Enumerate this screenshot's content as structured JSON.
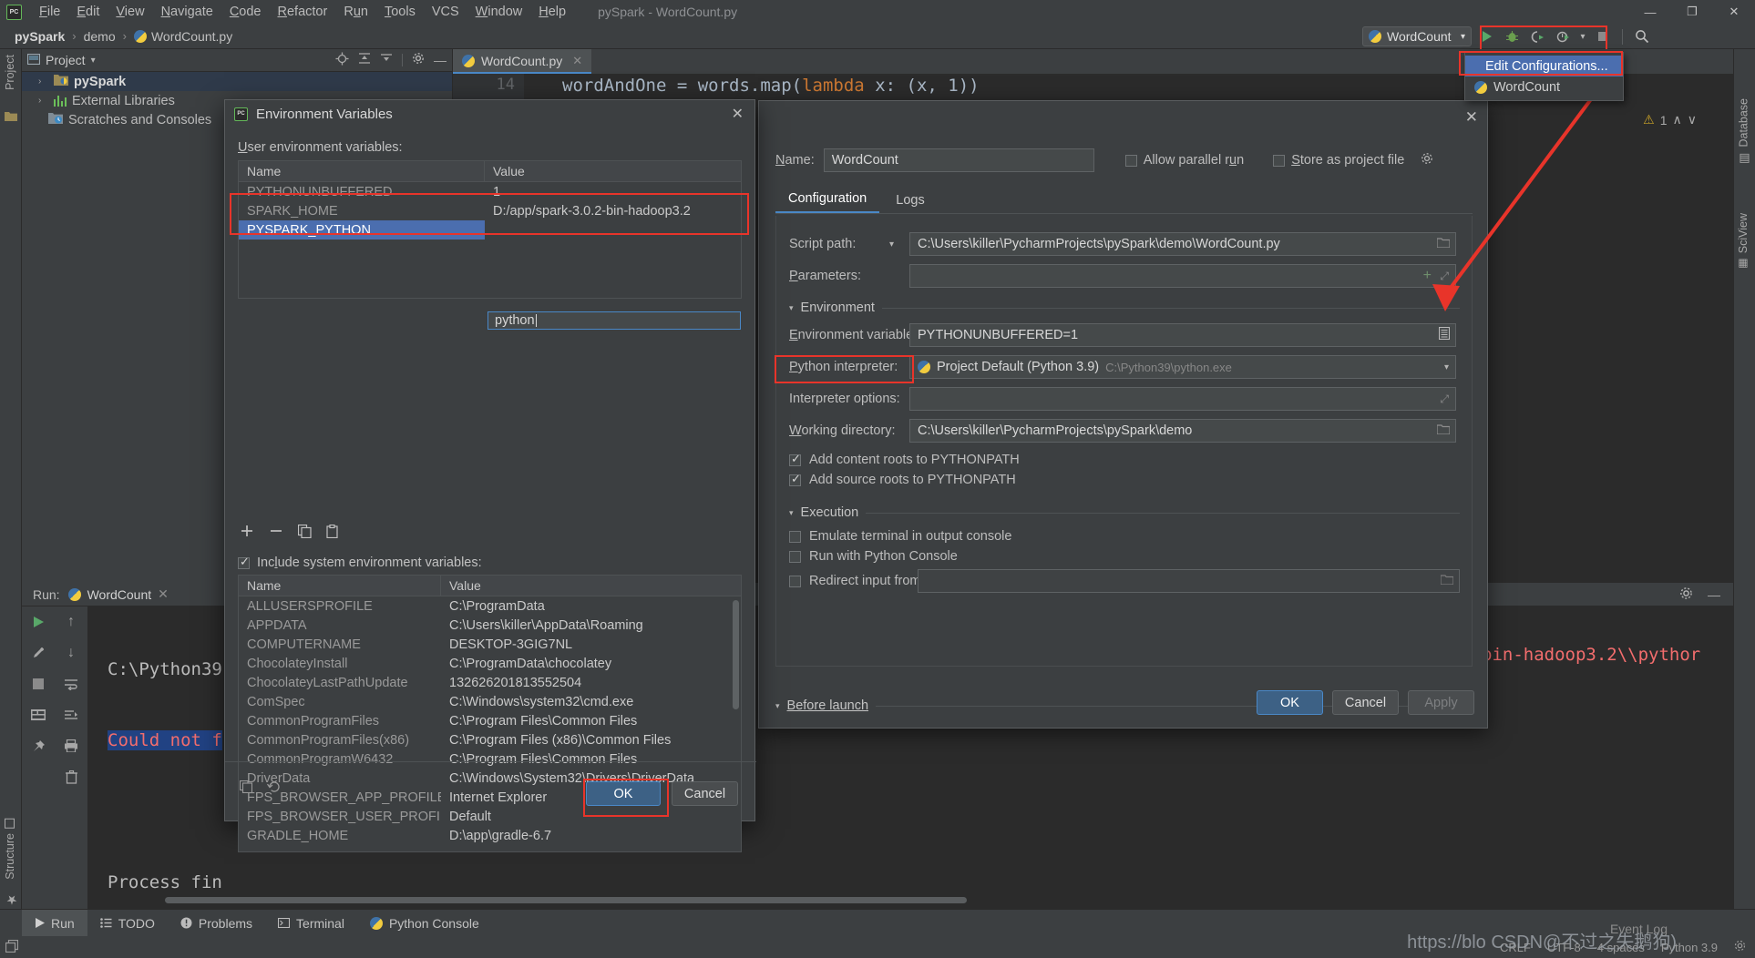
{
  "titlebar": {
    "logo": "PC",
    "menus": [
      "File",
      "Edit",
      "View",
      "Navigate",
      "Code",
      "Refactor",
      "Run",
      "Tools",
      "VCS",
      "Window",
      "Help"
    ],
    "window_title": "pySpark - WordCount.py",
    "minimize": "—",
    "maximize": "❐",
    "close": "✕"
  },
  "navbar": {
    "breadcrumb": [
      "pySpark",
      "demo",
      "WordCount.py"
    ],
    "separator": "›"
  },
  "run_widget": {
    "config_name": "WordCount",
    "caret": "▾",
    "run_icon": "run-icon",
    "debug_icon": "debug-icon",
    "coverage_icon": "coverage-icon",
    "profile_icon": "profile-icon",
    "stop_icon": "stop-icon",
    "search_icon": "search-icon",
    "dropdown": {
      "items": [
        {
          "label": "Edit Configurations...",
          "selected": true,
          "icon": null
        },
        {
          "label": "WordCount",
          "selected": false,
          "icon": "python-icon"
        }
      ]
    }
  },
  "left_strip": {
    "project_tab": "Project",
    "structure_tab": "Structure",
    "favorites_tab": "Favorites"
  },
  "right_strip": {
    "database_tab": "Database",
    "sciview_tab": "SciView"
  },
  "project_panel": {
    "title": "Project",
    "caret": "▾",
    "tree": [
      {
        "label": "pySpark",
        "arrow": "›",
        "icon": "python-module-folder-icon",
        "selected": true,
        "bold": true
      },
      {
        "label": "External Libraries",
        "arrow": "›",
        "icon": "libraries-icon",
        "selected": false,
        "bold": false
      },
      {
        "label": "Scratches and Consoles",
        "arrow": "",
        "icon": "scratches-icon",
        "selected": false,
        "bold": false
      }
    ]
  },
  "editor": {
    "tab_label": "WordCount.py",
    "tab_close": "✕",
    "line_number": "14",
    "code_pre": "wordAndOne = words.map(",
    "code_kw": "lambda",
    "code_post": " x: (x, 1))",
    "warning_count": "1",
    "warning_glyph": "⚠",
    "nav_up": "∧",
    "nav_down": "∨"
  },
  "run_panel": {
    "label": "Run:",
    "tab_name": "WordCount",
    "tab_close": "✕",
    "console_lines": [
      {
        "text": "C:\\Python39",
        "style": "plain"
      },
      {
        "text": "Could not f",
        "style": "error-highlight"
      },
      {
        "text": "",
        "style": "plain"
      },
      {
        "text": "Process fin",
        "style": "plain"
      }
    ],
    "console_right_text": "bin-hadoop3.2\\\\pythor",
    "settings_icon": "gear-icon",
    "hide_icon": "minimize-icon"
  },
  "bottombar": {
    "items": [
      {
        "label": "Run",
        "icon": "run-icon",
        "active": true
      },
      {
        "label": "TODO",
        "icon": "todo-icon",
        "active": false
      },
      {
        "label": "Problems",
        "icon": "problems-icon",
        "active": false
      },
      {
        "label": "Terminal",
        "icon": "terminal-icon",
        "active": false
      },
      {
        "label": "Python Console",
        "icon": "python-icon",
        "active": false
      }
    ]
  },
  "statusbar": {
    "line_sep": "CRLF",
    "encoding": "UTF-8",
    "indent": "4 spaces",
    "interpreter": "Python 3.9",
    "event_log": "Event Log",
    "gear_icon": "gear-icon",
    "watermark_url": "https://blo CSDN@不过之失鹅狗)",
    "watermark_alt": "https://blog.csdn.net"
  },
  "config_dialog": {
    "close": "✕",
    "name_label": "Name:",
    "name_value": "WordCount",
    "allow_parallel_label": "Allow parallel run",
    "allow_parallel_checked": false,
    "store_project_label": "Store as project file",
    "store_project_checked": false,
    "gear_icon": "gear-icon",
    "tabs": [
      {
        "label": "Configuration",
        "selected": true
      },
      {
        "label": "Logs",
        "selected": false
      }
    ],
    "script_path_label": "Script path:",
    "script_path_caret": "▾",
    "script_path_value": "C:\\Users\\killer\\PycharmProjects\\pySpark\\demo\\WordCount.py",
    "script_path_browse_icon": "folder-icon",
    "parameters_label": "Parameters:",
    "parameters_value": "",
    "parameters_add_icon": "plus-icon",
    "parameters_expand_icon": "expand-icon",
    "environment_section": "Environment",
    "env_vars_label": "Environment variables:",
    "env_vars_value": "PYTHONUNBUFFERED=1",
    "env_vars_browse_icon": "env-list-icon",
    "interpreter_label": "Python interpreter:",
    "interpreter_value": "Project Default (Python 3.9)",
    "interpreter_hint": "C:\\Python39\\python.exe",
    "interpreter_caret": "▾",
    "interpreter_options_label": "Interpreter options:",
    "interpreter_options_value": "",
    "interpreter_options_expand_icon": "expand-icon",
    "working_dir_label": "Working directory:",
    "working_dir_value": "C:\\Users\\killer\\PycharmProjects\\pySpark\\demo",
    "working_dir_browse_icon": "folder-icon",
    "add_content_roots_label": "Add content roots to PYTHONPATH",
    "add_content_roots_checked": true,
    "add_source_roots_label": "Add source roots to PYTHONPATH",
    "add_source_roots_checked": true,
    "execution_section": "Execution",
    "emulate_terminal_label": "Emulate terminal in output console",
    "emulate_terminal_checked": false,
    "run_python_console_label": "Run with Python Console",
    "run_python_console_checked": false,
    "redirect_input_label": "Redirect input from:",
    "redirect_input_checked": false,
    "redirect_input_value": "",
    "redirect_input_browse_icon": "folder-icon",
    "before_launch_section": "Before launch",
    "ok_label": "OK",
    "cancel_label": "Cancel",
    "apply_label": "Apply",
    "caret_glyph": "▾"
  },
  "env_dialog": {
    "logo": "PC",
    "title": "Environment Variables",
    "close": "✕",
    "user_section_label": "User environment variables:",
    "columns": [
      "Name",
      "Value"
    ],
    "user_rows": [
      {
        "name": "PYTHONUNBUFFERED",
        "value": "1",
        "selected": false,
        "editing": false
      },
      {
        "name": "SPARK_HOME",
        "value": "D:/app/spark-3.0.2-bin-hadoop3.2",
        "selected": false,
        "editing": false
      },
      {
        "name": "PYSPARK_PYTHON",
        "value": "python",
        "selected": true,
        "editing": true
      }
    ],
    "toolbar": {
      "add_icon": "plus-icon",
      "remove_icon": "minus-icon",
      "copy_icon": "copy-icon",
      "paste_icon": "paste-icon"
    },
    "include_system_label": "Include system environment variables:",
    "include_system_checked": true,
    "system_rows": [
      {
        "name": "ALLUSERSPROFILE",
        "value": "C:\\ProgramData"
      },
      {
        "name": "APPDATA",
        "value": "C:\\Users\\killer\\AppData\\Roaming"
      },
      {
        "name": "COMPUTERNAME",
        "value": "DESKTOP-3GIG7NL"
      },
      {
        "name": "ChocolateyInstall",
        "value": "C:\\ProgramData\\chocolatey"
      },
      {
        "name": "ChocolateyLastPathUpdate",
        "value": "132626201813552504"
      },
      {
        "name": "ComSpec",
        "value": "C:\\Windows\\system32\\cmd.exe"
      },
      {
        "name": "CommonProgramFiles",
        "value": "C:\\Program Files\\Common Files"
      },
      {
        "name": "CommonProgramFiles(x86)",
        "value": "C:\\Program Files (x86)\\Common Files"
      },
      {
        "name": "CommonProgramW6432",
        "value": "C:\\Program Files\\Common Files"
      },
      {
        "name": "DriverData",
        "value": "C:\\Windows\\System32\\Drivers\\DriverData"
      },
      {
        "name": "FPS_BROWSER_APP_PROFILE_STRING",
        "value": "Internet Explorer"
      },
      {
        "name": "FPS_BROWSER_USER_PROFILE_STRING",
        "value": "Default"
      },
      {
        "name": "GRADLE_HOME",
        "value": "D:\\app\\gradle-6.7"
      }
    ],
    "bottom_tools": {
      "copy_all_icon": "copy-icon",
      "revert_icon": "revert-icon"
    },
    "ok_label": "OK",
    "cancel_label": "Cancel"
  },
  "colors": {
    "accent_blue": "#4b6eaf",
    "highlight_red": "#e8342a",
    "panel_bg": "#3c3f41",
    "editor_bg": "#2b2b2b",
    "button_primary": "#3d6185",
    "error_text": "#f26d6d"
  }
}
